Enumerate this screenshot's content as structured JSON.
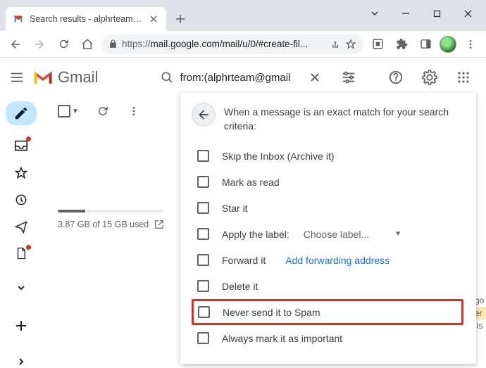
{
  "window": {
    "tab_title": "Search results - alphrteam@gmai...",
    "url_proto": "https://",
    "url_rest": "mail.google.com/mail/u/0/#create-fil..."
  },
  "gmail": {
    "logo_text": "Gmail",
    "search_value": "from:(alphrteam@gmail",
    "storage_text": "3.87 GB of 15 GB used"
  },
  "filter": {
    "heading": "When a message is an exact match for your search criteria:",
    "options": [
      {
        "label": "Skip the Inbox (Archive it)"
      },
      {
        "label": "Mark as read"
      },
      {
        "label": "Star it"
      },
      {
        "label": "Apply the label:",
        "extra": "Choose label...",
        "has_chev": true
      },
      {
        "label": "Forward it",
        "link": "Add forwarding address"
      },
      {
        "label": "Delete it"
      },
      {
        "label": "Never send it to Spam",
        "highlight": true
      },
      {
        "label": "Always mark it as important"
      }
    ]
  },
  "peek": {
    "l1": "go",
    "l2": "er",
    "l3": "ils"
  }
}
